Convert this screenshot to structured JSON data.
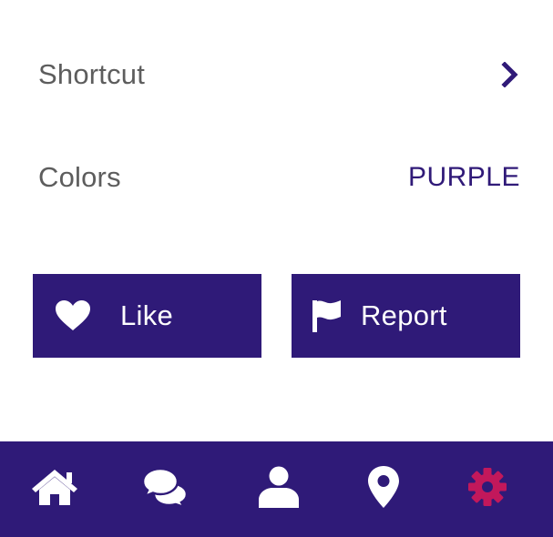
{
  "settings": {
    "shortcut_label": "Shortcut",
    "colors_label": "Colors",
    "colors_value": "PURPLE"
  },
  "actions": {
    "like_label": "Like",
    "report_label": "Report"
  },
  "tab_bar": {
    "tabs": [
      {
        "icon": "home-icon",
        "active": false
      },
      {
        "icon": "chat-icon",
        "active": false
      },
      {
        "icon": "user-icon",
        "active": false
      },
      {
        "icon": "location-pin-icon",
        "active": false
      },
      {
        "icon": "gear-icon",
        "active": true
      }
    ]
  },
  "colors": {
    "primary": "#2f1a78",
    "active_tab": "#c2185b",
    "label_gray": "#5d5d5d"
  }
}
